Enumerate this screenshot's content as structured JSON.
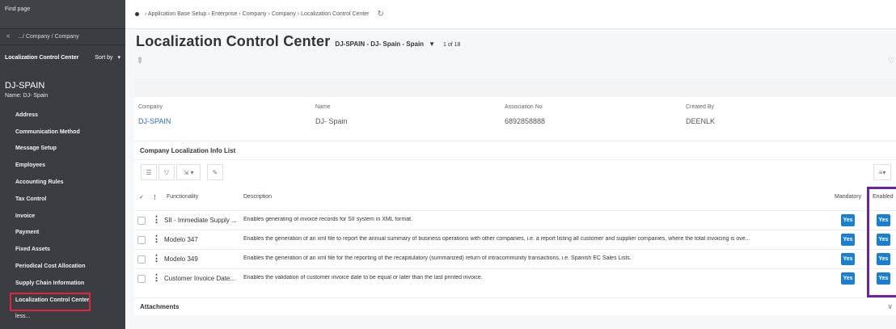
{
  "sidebar": {
    "find_page": "Find page",
    "back_label": ".../ Company / Company",
    "list_label": "Localization Control Center",
    "sort_label": "Sort by",
    "record_id": "DJ-SPAIN",
    "record_name": "Name:  DJ- Spain",
    "items": [
      "Address",
      "Communication Method",
      "Message Setup",
      "Employees",
      "Accounting Rules",
      "Tax Control",
      "Invoice",
      "Payment",
      "Fixed Assets",
      "Periodical Cost Allocation",
      "Supply Chain Information",
      "Localization Control Center"
    ],
    "less_label": "less..."
  },
  "breadcrumb": [
    "Application Base Setup",
    "Enterprise",
    "Company",
    "Company",
    "Localization Control Center"
  ],
  "page": {
    "title": "Localization Control Center",
    "subtitle": "DJ-SPAIN - DJ- Spain - Spain",
    "pager": "1 of 18"
  },
  "header": {
    "company_label": "Company",
    "company_value": "DJ-SPAIN",
    "name_label": "Name",
    "name_value": "DJ- Spain",
    "assoc_label": "Association No",
    "assoc_value": "6892858888",
    "created_label": "Created By",
    "created_value": "DEENLK"
  },
  "list": {
    "title": "Company Localization Info List",
    "columns": {
      "functionality": "Functionality",
      "description": "Description",
      "mandatory": "Mandatory",
      "enabled": "Enabled"
    },
    "rows": [
      {
        "functionality": "SII - Immediate Supply ...",
        "description": "Enables generating of invoice records for SII system in XML format.",
        "mandatory": "Yes",
        "enabled": "Yes"
      },
      {
        "functionality": "Modelo 347",
        "description": "Enables the generation of an xml file to report the annual summary of business operations with other companies, i.e. a report listing all customer and supplier companies, where the total invoicing is ove...",
        "mandatory": "Yes",
        "enabled": "Yes"
      },
      {
        "functionality": "Modelo 349",
        "description": "Enables the generation of an xml file for the reporting of the recapitulatory (summarized) return of intracommunity transactions, i.e. Spanish EC Sales Lists.",
        "mandatory": "Yes",
        "enabled": "Yes"
      },
      {
        "functionality": "Customer Invoice Date...",
        "description": "Enables the validation of customer invoice date to be equal or later than the last printed invoice.",
        "mandatory": "Yes",
        "enabled": "Yes"
      }
    ]
  },
  "attachments_label": "Attachments",
  "colors": {
    "sidebar_bg": "#3a3e43",
    "accent_blue": "#1a7fd1",
    "active_outline": "#e0263a",
    "highlight_purple": "#6b21a8"
  }
}
